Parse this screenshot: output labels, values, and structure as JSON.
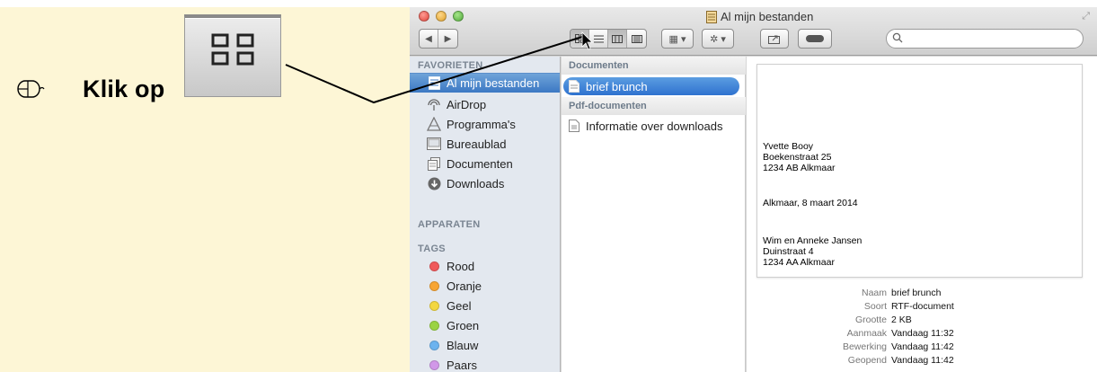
{
  "instruction": {
    "text": "Klik op",
    "mouse_icon": "mouse-icon",
    "button_icon": "icon-view-grid-icon"
  },
  "window": {
    "title": "Al mijn bestanden",
    "search_placeholder": ""
  },
  "toolbar": {
    "nav": [
      "◀",
      "▶"
    ],
    "views": [
      "icon-view",
      "list-view",
      "column-view",
      "coverflow-view"
    ],
    "arrange": "arrange-menu",
    "action": "action-menu",
    "share": "share",
    "tags": "tags"
  },
  "sidebar": {
    "favorites_header": "FAVORIETEN",
    "favorites": [
      {
        "label": "Al mijn bestanden",
        "icon": "all-files-icon",
        "selected": true
      },
      {
        "label": "AirDrop",
        "icon": "airdrop-icon"
      },
      {
        "label": "Programma's",
        "icon": "applications-icon"
      },
      {
        "label": "Bureaublad",
        "icon": "desktop-icon"
      },
      {
        "label": "Documenten",
        "icon": "documents-icon"
      },
      {
        "label": "Downloads",
        "icon": "downloads-icon"
      }
    ],
    "devices_header": "APPARATEN",
    "tags_header": "TAGS",
    "tags": [
      {
        "label": "Rood",
        "color": "#f0595b"
      },
      {
        "label": "Oranje",
        "color": "#f7a534"
      },
      {
        "label": "Geel",
        "color": "#f3d740"
      },
      {
        "label": "Groen",
        "color": "#9ad343"
      },
      {
        "label": "Blauw",
        "color": "#6cb3ef"
      },
      {
        "label": "Paars",
        "color": "#d198e8"
      }
    ]
  },
  "column": {
    "group1_header": "Documenten",
    "group1_files": [
      {
        "label": "brief brunch",
        "selected": true
      }
    ],
    "group2_header": "Pdf-documenten",
    "group2_files": [
      {
        "label": "Informatie over downloads"
      }
    ]
  },
  "preview": {
    "doc_lines": [
      "Yvette Booy",
      "Boekenstraat 25",
      "1234 AB Alkmaar",
      "Alkmaar, 8 maart 2014",
      "Wim en Anneke Jansen",
      "Duinstraat 4",
      "1234 AA Alkmaar"
    ],
    "info": [
      {
        "k": "Naam",
        "v": "brief brunch"
      },
      {
        "k": "Soort",
        "v": "RTF-document"
      },
      {
        "k": "Grootte",
        "v": "2 KB"
      },
      {
        "k": "Aanmaak",
        "v": "Vandaag 11:32"
      },
      {
        "k": "Bewerking",
        "v": "Vandaag 11:42"
      },
      {
        "k": "Geopend",
        "v": "Vandaag 11:42"
      }
    ]
  },
  "colors": {
    "instruction_bg": "#fdf6d6",
    "selection_blue": "#3b78c4",
    "sidebar_bg": "#e3e8ef"
  }
}
